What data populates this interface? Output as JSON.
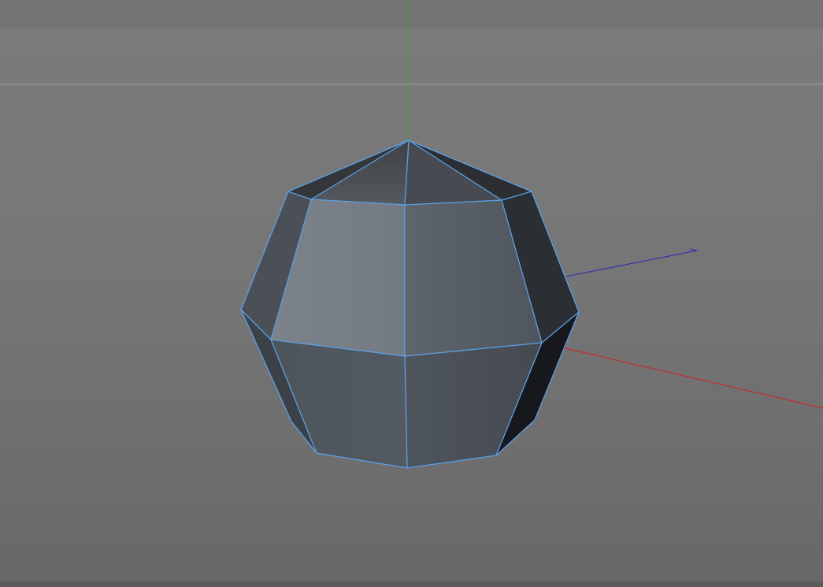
{
  "viewport": {
    "label": "",
    "mode": "perspective"
  },
  "scene": {
    "object_type": "polyhedron",
    "selected": true,
    "selection_edge_color": "#5aa0e6",
    "axis_colors": {
      "x": "#d42020",
      "y": "#3aa63a",
      "z": "#2a2ab8"
    },
    "horizon_color": "#a4a4a4"
  },
  "colors": {
    "background_top": "#7a7a7a",
    "background_bottom": "#676767"
  }
}
